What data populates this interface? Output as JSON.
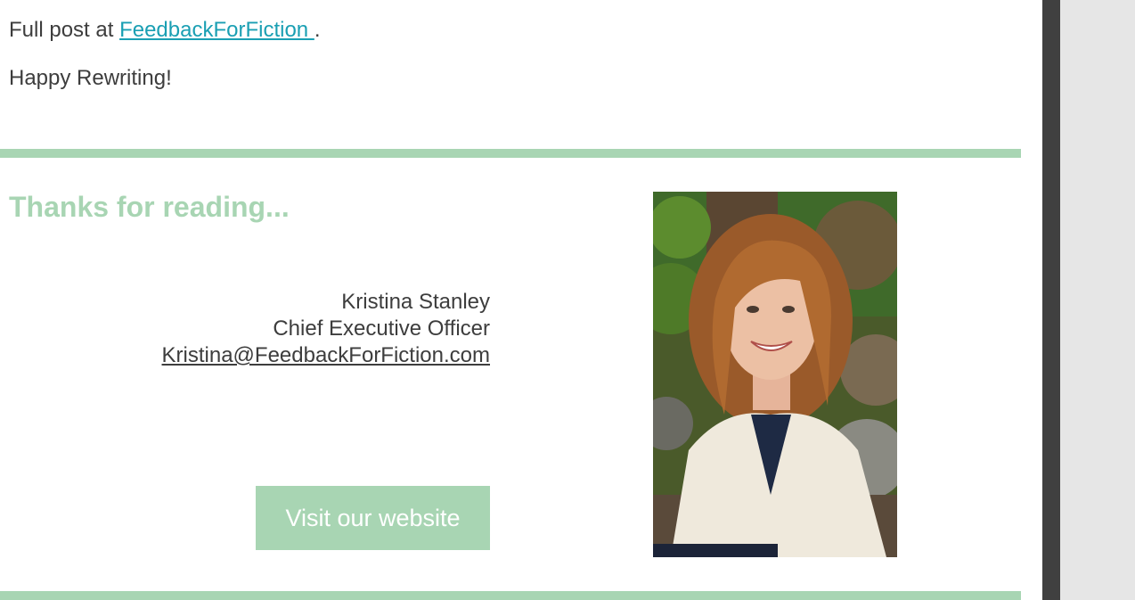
{
  "post": {
    "prefix": "Full post at ",
    "link_text": "FeedbackForFiction ",
    "suffix": ".",
    "closing": "Happy Rewriting!"
  },
  "signoff": {
    "heading": "Thanks for reading...",
    "name": "Kristina Stanley",
    "title": "Chief Executive Officer",
    "email": "Kristina@FeedbackForFiction.com",
    "button_label": "Visit our website",
    "photo_icon": "portrait-photo"
  },
  "colors": {
    "accent_green": "#a8d5b3",
    "link": "#1a9fb3",
    "body_text": "#3d3d3d",
    "scroll_track": "#404040",
    "gutter": "#e6e6e6"
  }
}
